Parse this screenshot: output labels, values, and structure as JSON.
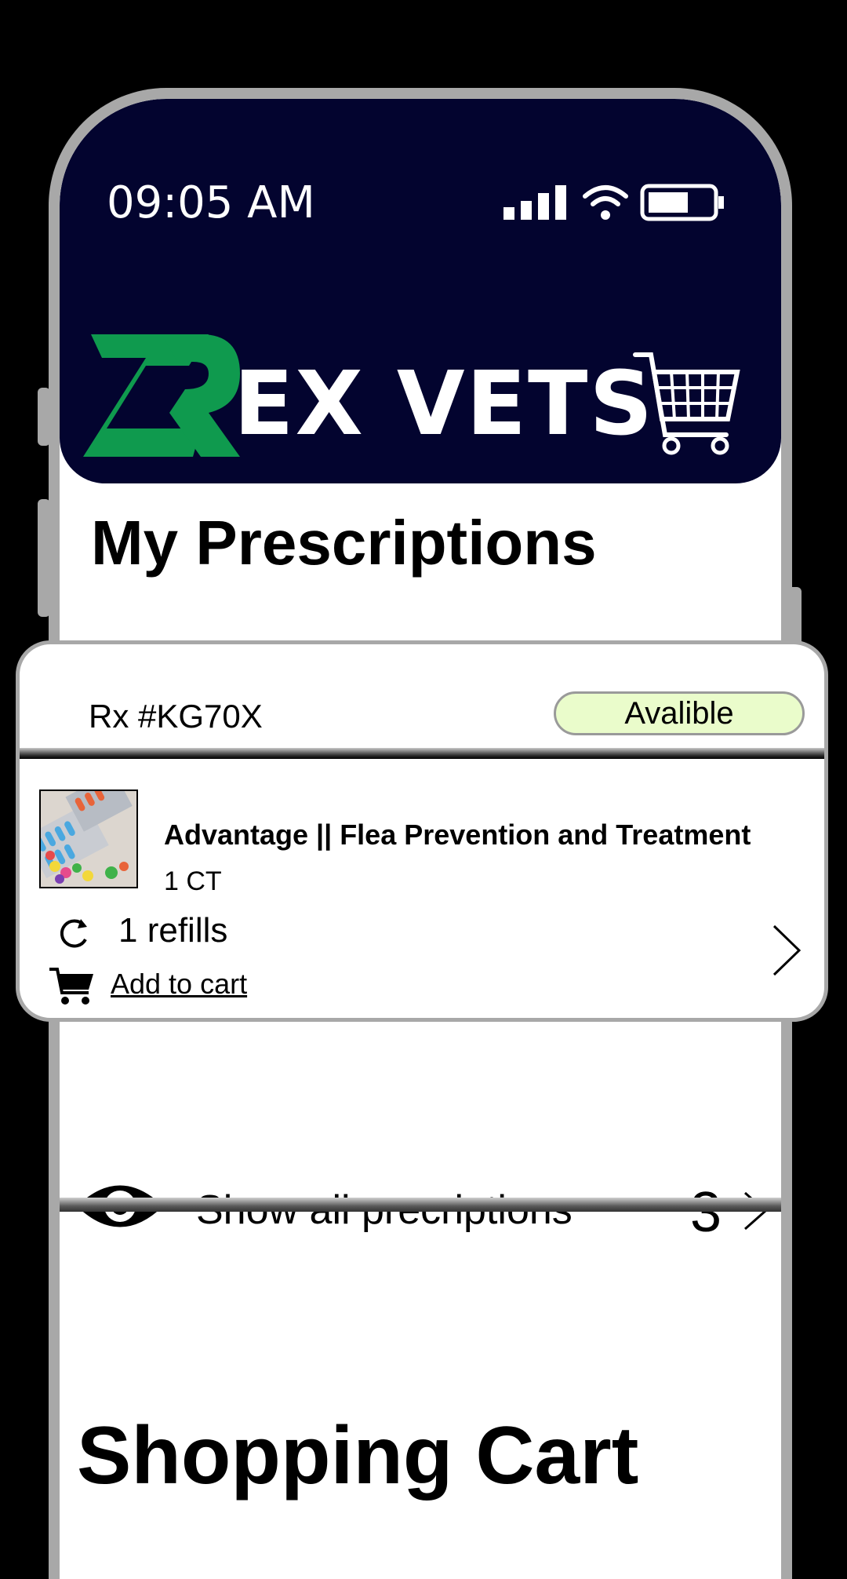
{
  "status_bar": {
    "time": "09:05 AM",
    "icons": [
      "signal-icon",
      "wifi-icon",
      "battery-icon"
    ]
  },
  "header": {
    "brand": "EX VETS",
    "logo_icon": "rex-logo-icon",
    "cart_icon": "cart-icon"
  },
  "prescriptions": {
    "title": "My Prescriptions",
    "card": {
      "rx_number": "Rx #KG70X",
      "status": "Avalible",
      "product_name": "Advantage || Flea Prevention and Treatment",
      "quantity": "1 CT",
      "refills": "1 refills",
      "add_to_cart": "Add to cart"
    },
    "show_all": {
      "label": "Show all precriptions",
      "count": "3"
    }
  },
  "shopping_cart": {
    "title": "Shopping Cart"
  },
  "colors": {
    "header_bg": "#03042f",
    "logo_green": "#0f9a4e",
    "badge_bg": "#eafccb",
    "frame": "#a8a8a8"
  }
}
